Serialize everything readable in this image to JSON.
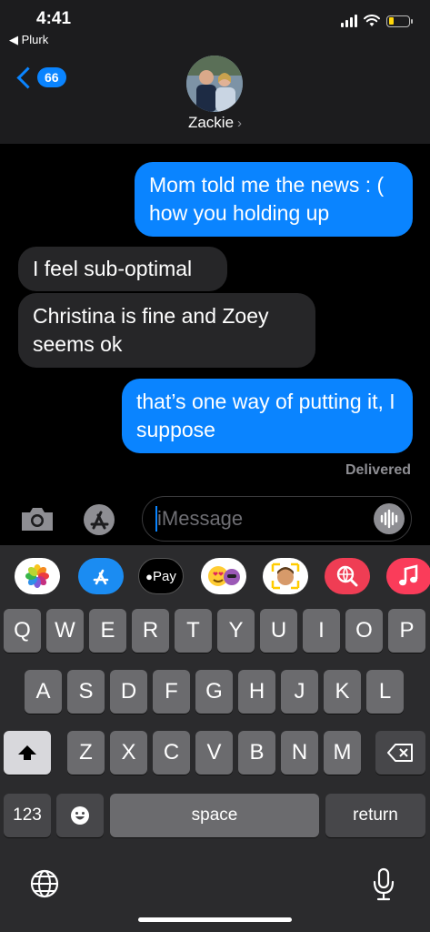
{
  "status_bar": {
    "time": "4:41",
    "back_app": "◀ Plurk"
  },
  "header": {
    "unread_count": "66",
    "contact_name": "Zackie"
  },
  "messages": [
    {
      "direction": "out",
      "text": "Mom told me the news : ( how you holding up"
    },
    {
      "direction": "in",
      "text": "I feel sub-optimal"
    },
    {
      "direction": "in",
      "text": "Christina is fine and Zoey seems ok"
    },
    {
      "direction": "out",
      "text": "that’s one way of putting it, I suppose"
    }
  ],
  "delivery_status": "Delivered",
  "input": {
    "placeholder": "iMessage",
    "value": ""
  },
  "app_strip": {
    "apple_pay_label": "Pay"
  },
  "keyboard": {
    "row1": [
      "Q",
      "W",
      "E",
      "R",
      "T",
      "Y",
      "U",
      "I",
      "O",
      "P"
    ],
    "row2": [
      "A",
      "S",
      "D",
      "F",
      "G",
      "H",
      "J",
      "K",
      "L"
    ],
    "row3": [
      "Z",
      "X",
      "C",
      "V",
      "B",
      "N",
      "M"
    ],
    "numbers_label": "123",
    "space_label": "space",
    "return_label": "return"
  },
  "colors": {
    "accent": "#0a84ff",
    "incoming_bubble": "#262628",
    "keyboard_bg": "#2b2b2d"
  }
}
